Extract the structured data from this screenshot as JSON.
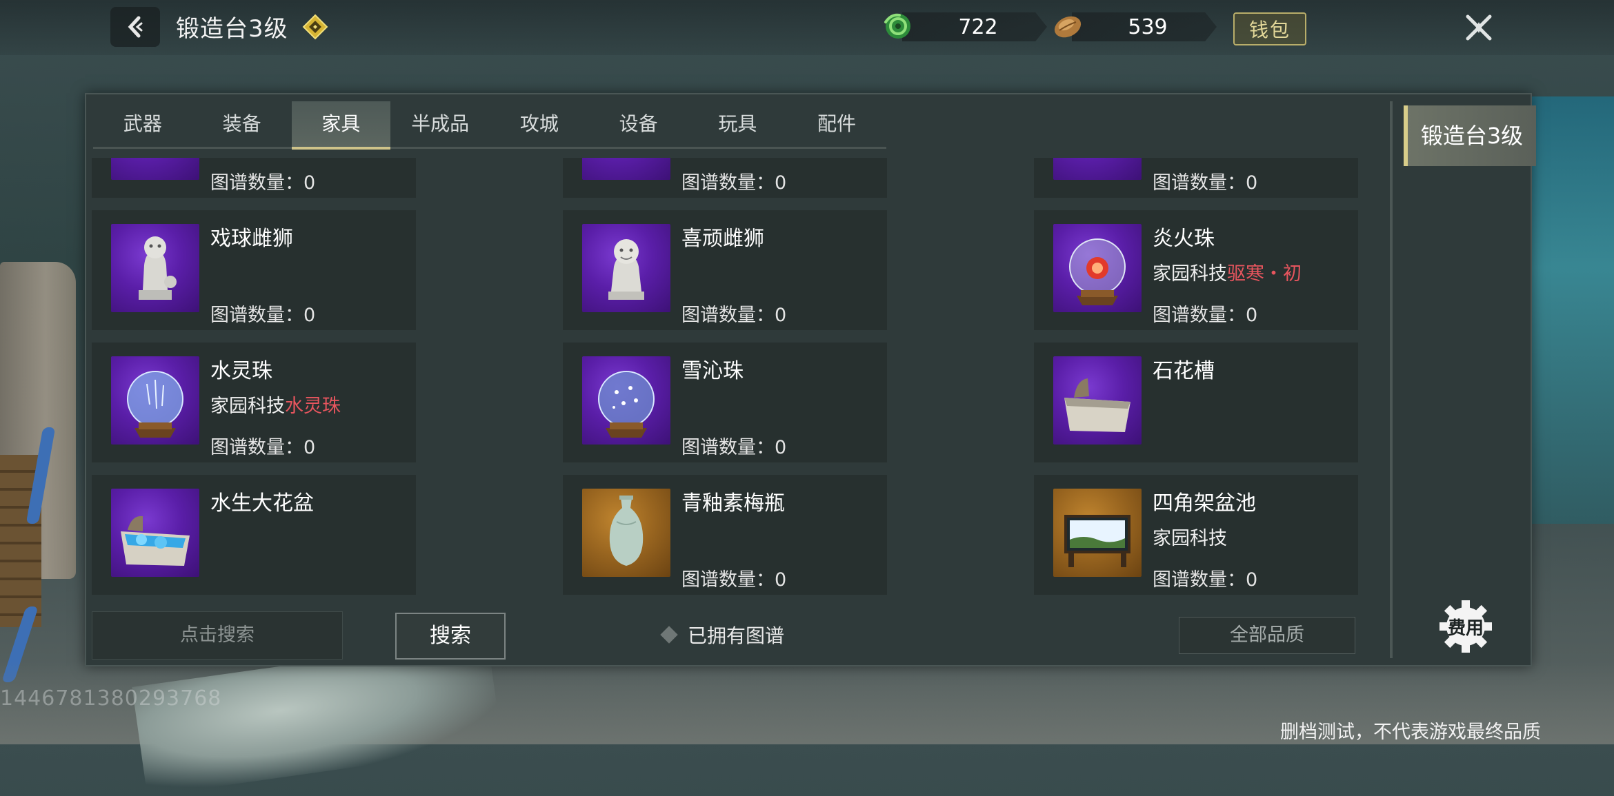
{
  "header": {
    "title": "锻造台3级",
    "back_icon": "chevron-left-icon",
    "badge_icon": "diamond-badge-icon",
    "currencies": [
      {
        "icon": "jade-coin-icon",
        "value": "722"
      },
      {
        "icon": "seed-coin-icon",
        "value": "539"
      }
    ],
    "wallet_label": "钱包",
    "close_icon": "close-x-icon"
  },
  "tabs": [
    {
      "label": "武器"
    },
    {
      "label": "装备"
    },
    {
      "label": "家具",
      "active": true
    },
    {
      "label": "半成品"
    },
    {
      "label": "攻城"
    },
    {
      "label": "设备"
    },
    {
      "label": "玩具"
    },
    {
      "label": "配件"
    }
  ],
  "partial_row": [
    {
      "count": "图谱数量：0"
    },
    {
      "count": "图谱数量：0"
    },
    {
      "count": "图谱数量：0"
    }
  ],
  "items": [
    {
      "name": "戏球雌狮",
      "icon": "lion-statue-icon",
      "bg": "purple",
      "tech_prefix": "",
      "tech_highlight": "",
      "count": "图谱数量：0"
    },
    {
      "name": "喜顽雌狮",
      "icon": "lion-statue-icon",
      "bg": "purple",
      "tech_prefix": "",
      "tech_highlight": "",
      "count": "图谱数量：0"
    },
    {
      "name": "炎火珠",
      "icon": "fire-orb-icon",
      "bg": "purple",
      "tech_prefix": "家园科技",
      "tech_highlight": "驱寒・初",
      "count": "图谱数量：0"
    },
    {
      "name": "水灵珠",
      "icon": "water-orb-icon",
      "bg": "purple",
      "tech_prefix": "家园科技",
      "tech_highlight": "水灵珠",
      "count": "图谱数量：0"
    },
    {
      "name": "雪沁珠",
      "icon": "snow-orb-icon",
      "bg": "purple",
      "tech_prefix": "",
      "tech_highlight": "",
      "count": "图谱数量：0"
    },
    {
      "name": "石花槽",
      "icon": "stone-trough-icon",
      "bg": "purple",
      "tech_prefix": "",
      "tech_highlight": "",
      "count": ""
    },
    {
      "name": "水生大花盆",
      "icon": "flower-basin-icon",
      "bg": "purple",
      "tech_prefix": "",
      "tech_highlight": "",
      "count": ""
    },
    {
      "name": "青釉素梅瓶",
      "icon": "vase-icon",
      "bg": "amber",
      "tech_prefix": "",
      "tech_highlight": "",
      "count": "图谱数量：0"
    },
    {
      "name": "四角架盆池",
      "icon": "aquarium-icon",
      "bg": "amber",
      "tech_prefix": "家园科技",
      "tech_highlight": "",
      "count": "图谱数量：0"
    }
  ],
  "footer": {
    "search_placeholder": "点击搜索",
    "search_button": "搜索",
    "owned_label": "已拥有图谱",
    "quality_select": "全部品质",
    "cost_label": "费用"
  },
  "side_tab": "锻造台3级",
  "watermark_id": "1446781380293768",
  "disclaimer": "删档测试，不代表游戏最终品质",
  "colors": {
    "highlight": "#e7555e",
    "accent": "#d8cd8a",
    "panel": "#2f3a3a"
  }
}
